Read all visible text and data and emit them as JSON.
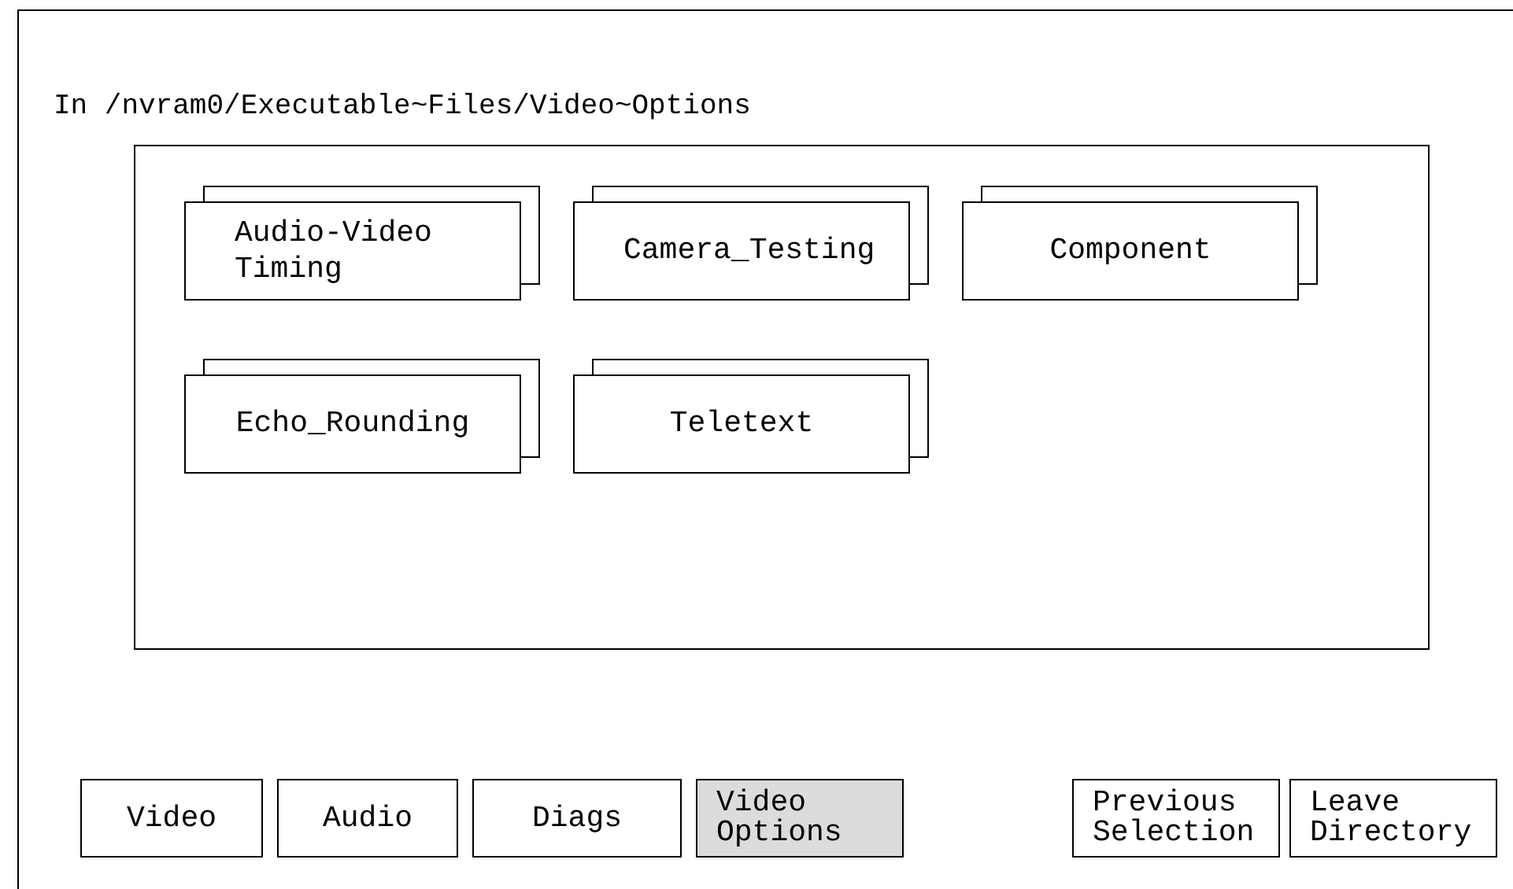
{
  "path": "In /nvram0/Executable~Files/Video~Options",
  "folders": [
    {
      "label": "Audio-Video Timing"
    },
    {
      "label": "Camera_Testing"
    },
    {
      "label": "Component"
    },
    {
      "label": "Echo_Rounding"
    },
    {
      "label": "Teletext"
    }
  ],
  "buttons": [
    {
      "label": "Video",
      "selected": false
    },
    {
      "label": "Audio",
      "selected": false
    },
    {
      "label": "Diags",
      "selected": false
    },
    {
      "label": "Video Options",
      "selected": true
    },
    {
      "label": "Previous Selection",
      "selected": false
    },
    {
      "label": "Leave Directory",
      "selected": false
    }
  ]
}
